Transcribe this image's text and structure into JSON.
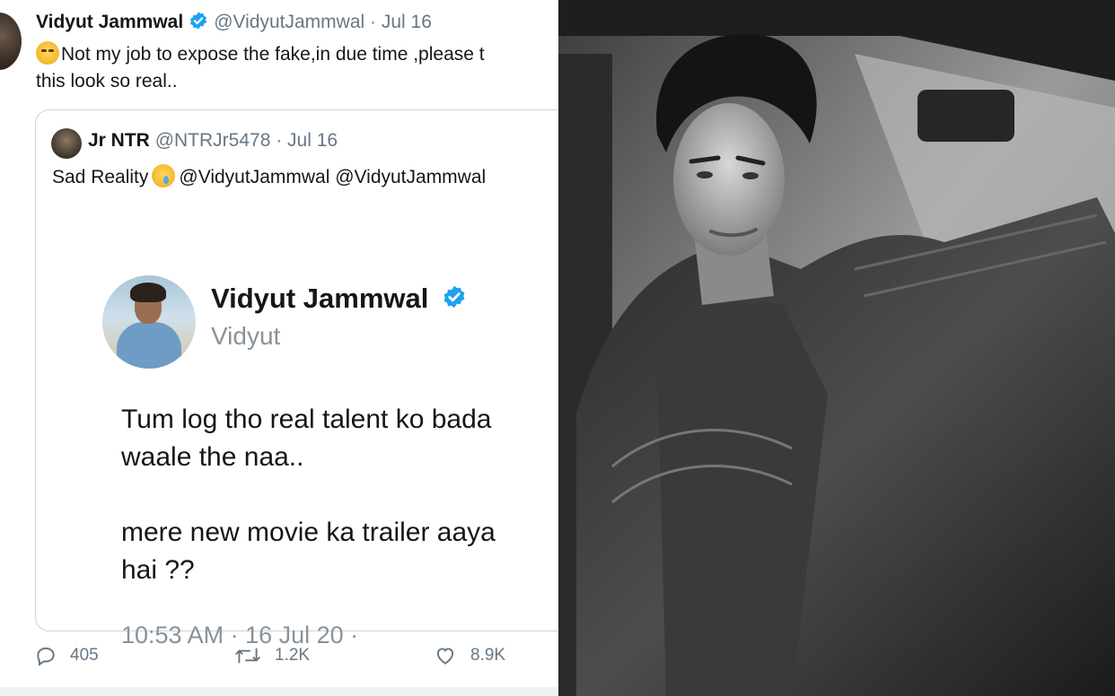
{
  "tweet": {
    "author_name": "Vidyut Jammwal",
    "handle": "@VidyutJammwal",
    "date": "· Jul 16",
    "text_line1": "Not my job to expose the fake,in due time ,please t",
    "text_line2": "this look so real..",
    "actions": {
      "replies": "405",
      "retweets": "1.2K",
      "likes": "8.9K"
    }
  },
  "quote": {
    "author_name": "Jr NTR",
    "handle": "@NTRJr5478",
    "date": "· Jul 16",
    "text_prefix": "Sad Reality",
    "text_suffix": "@VidyutJammwal @VidyutJammwal"
  },
  "inner": {
    "name": "Vidyut Jammwal",
    "handle": "Vidyut",
    "body": "Tum log tho real talent ko bada\nwaale the naa..\n\nmere new movie ka trailer aaya\nhai ??",
    "timestamp": "10:53 AM · 16 Jul 20 ·"
  },
  "colors": {
    "verified_blue": "#1da1f2",
    "text": "#14171a",
    "muted": "#657786"
  }
}
